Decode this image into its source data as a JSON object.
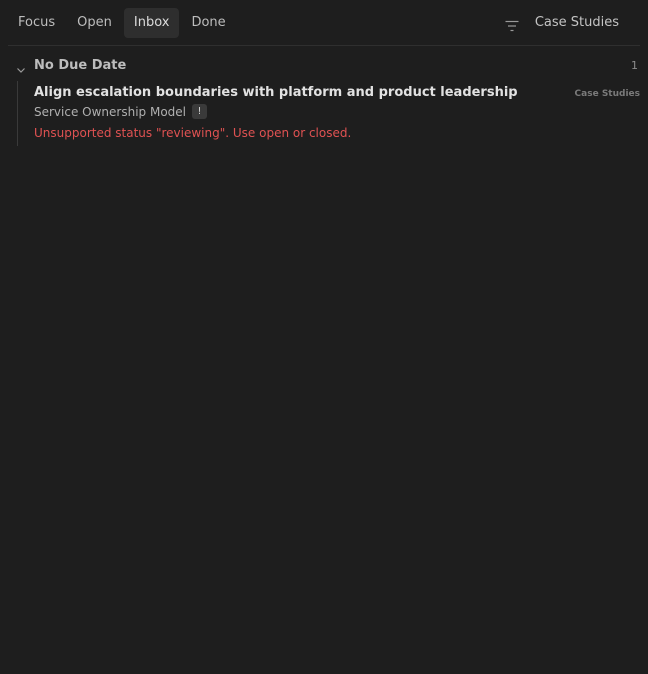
{
  "tabs": [
    {
      "label": "Focus",
      "active": false
    },
    {
      "label": "Open",
      "active": false
    },
    {
      "label": "Inbox",
      "active": true
    },
    {
      "label": "Done",
      "active": false
    }
  ],
  "filter": {
    "icon": "filter-icon",
    "label": "Case Studies"
  },
  "group": {
    "icon": "chevron-down-icon",
    "title": "No Due Date",
    "count": "1"
  },
  "task": {
    "title": "Align escalation boundaries with platform and product leadership",
    "project": "Case Studies",
    "subtitle": "Service Ownership Model",
    "badge": "!",
    "error": "Unsupported status \"reviewing\". Use open or closed."
  },
  "colors": {
    "background": "#1e1e1e",
    "active_tab": "#2e2e2e",
    "error": "#e05252"
  }
}
